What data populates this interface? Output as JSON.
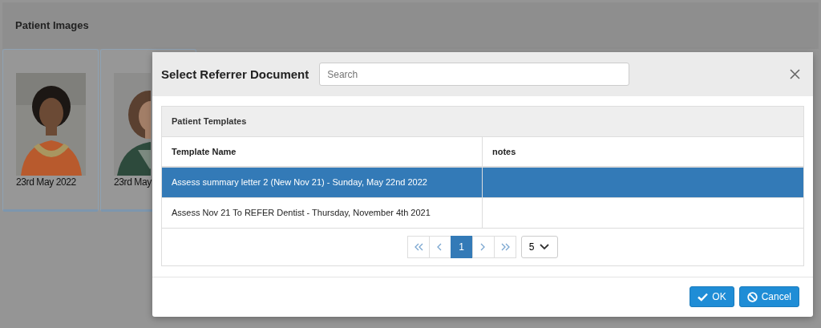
{
  "panel": {
    "title": "Patient Images"
  },
  "images": [
    {
      "kind": "picture",
      "date": "23rd May 2022"
    },
    {
      "kind": "picture",
      "date": "23rd May"
    }
  ],
  "modal": {
    "title": "Select Referrer Document",
    "search": {
      "placeholder": "Search"
    },
    "table": {
      "caption": "Patient Templates",
      "columns": [
        "Template Name",
        "notes"
      ],
      "rows": [
        {
          "name": "Assess summary letter 2 (New Nov 21) - Sunday, May 22nd 2022",
          "selected": true
        },
        {
          "name": "Assess Nov 21 To REFER Dentist - Thursday, November 4th 2021",
          "selected": false
        }
      ]
    },
    "pagination": {
      "buttons": [
        {
          "kind": "first"
        },
        {
          "kind": "prev"
        },
        {
          "kind": "page",
          "label": "1",
          "selected": true
        },
        {
          "kind": "next"
        },
        {
          "kind": "last"
        }
      ],
      "page_size": "5"
    },
    "buttons": [
      {
        "kind": "ok",
        "label": "OK"
      },
      {
        "kind": "cancel",
        "label": "Cancel"
      }
    ]
  }
}
